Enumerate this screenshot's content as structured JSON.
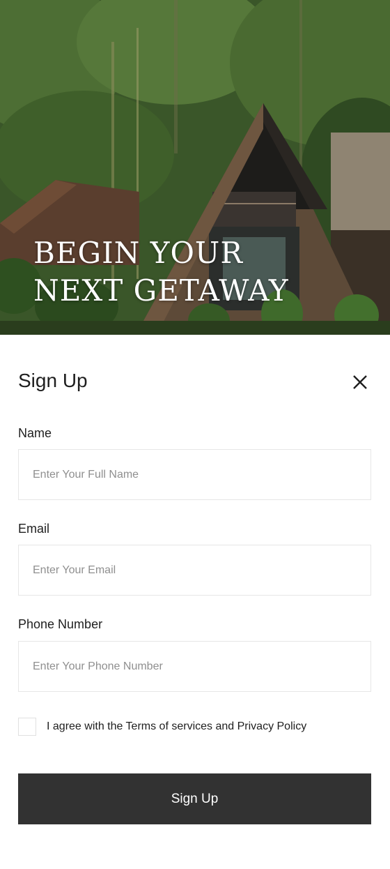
{
  "hero": {
    "image": "forest-a-frame-cabins-photo",
    "title_line1": "BEGIN YOUR",
    "title_line2": "NEXT GETAWAY"
  },
  "signup": {
    "title": "Sign Up",
    "close_icon": "close-icon",
    "fields": [
      {
        "label": "Name",
        "placeholder": "Enter Your Full Name",
        "value": ""
      },
      {
        "label": "Email",
        "placeholder": "Enter Your Email",
        "value": ""
      },
      {
        "label": "Phone Number",
        "placeholder": "Enter Your Phone Number",
        "value": ""
      }
    ],
    "agree": {
      "checked": false,
      "text": "I agree with the Terms of services and Privacy Policy"
    },
    "submit_label": "Sign Up"
  },
  "colors": {
    "button_bg": "#323232",
    "button_text": "#ffffff",
    "input_border": "#e6e6e6",
    "text": "#1e1e1e",
    "placeholder": "#8f8f8f"
  }
}
